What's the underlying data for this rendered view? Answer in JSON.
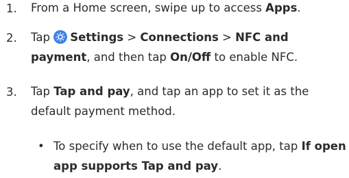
{
  "steps": [
    {
      "number": "1.",
      "parts": [
        "From a Home screen, swipe up to access ",
        "Apps",
        "."
      ]
    },
    {
      "number": "2.",
      "parts": [
        "Tap ",
        "Settings",
        " > ",
        "Connections",
        " > ",
        "NFC and payment",
        ", and then tap ",
        "On/Off",
        " to enable NFC."
      ]
    },
    {
      "number": "3.",
      "parts": [
        "Tap ",
        "Tap and pay",
        ", and tap an app to set it as the default payment method."
      ],
      "subbullet": {
        "bullet": "•",
        "parts": [
          "To specify when to use the default app, tap ",
          "If open app supports Tap and pay",
          "."
        ]
      }
    }
  ],
  "icons": {
    "settings": "settings-gear-icon"
  },
  "colors": {
    "text": "#2b2b2b",
    "icon_blue": "#3d82e8"
  }
}
